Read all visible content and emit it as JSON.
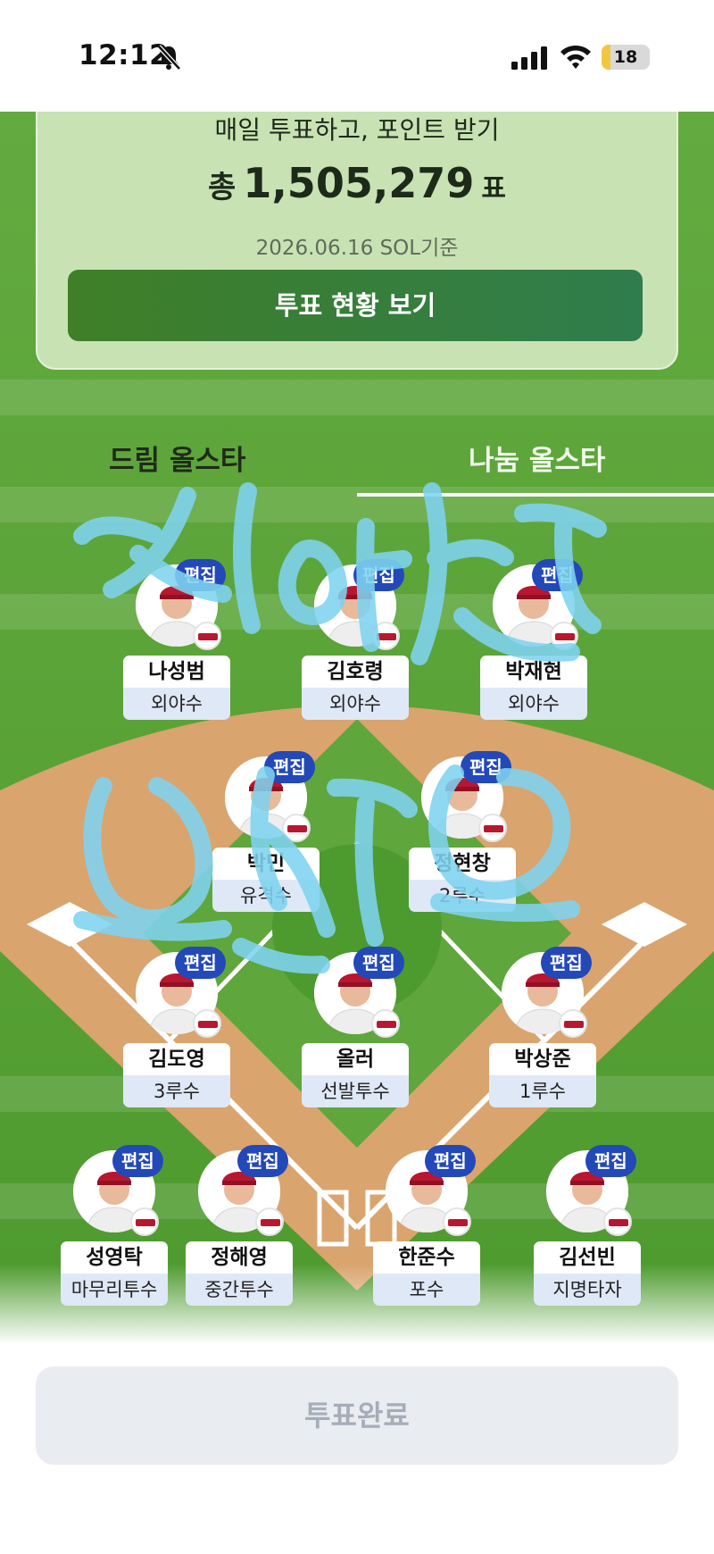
{
  "status_bar": {
    "time": "12:12",
    "battery_level": "18",
    "battery_fraction": 0.18
  },
  "vote_card": {
    "subtitle": "매일 투표하고, 포인트 받기",
    "total_prefix": "총",
    "total_votes": "1,505,279",
    "total_suffix": "표",
    "date": "2026.06.16 SOL기준",
    "status_button_label": "투표 현황 보기"
  },
  "tabs": [
    {
      "label": "드림 올스타",
      "selected": false
    },
    {
      "label": "나눔 올스타",
      "selected": true
    }
  ],
  "edit_label": "편집",
  "players": [
    {
      "name": "나성범",
      "position": "외야수"
    },
    {
      "name": "김호령",
      "position": "외야수"
    },
    {
      "name": "박재현",
      "position": "외야수"
    },
    {
      "name": "박민",
      "position": "유격수"
    },
    {
      "name": "정현창",
      "position": "2루수"
    },
    {
      "name": "김도영",
      "position": "3루수"
    },
    {
      "name": "올러",
      "position": "선발투수"
    },
    {
      "name": "박상준",
      "position": "1루수"
    },
    {
      "name": "성영탁",
      "position": "마무리투수"
    },
    {
      "name": "정해영",
      "position": "중간투수"
    },
    {
      "name": "한준수",
      "position": "포수"
    },
    {
      "name": "김선빈",
      "position": "지명타자"
    }
  ],
  "complete_button_label": "투표완료",
  "colors": {
    "grass": "#5fa63c",
    "dirt": "#d9a46e",
    "edit_badge": "#2348b8",
    "team": "#b8172f",
    "scribble": "#7fd3f0"
  }
}
